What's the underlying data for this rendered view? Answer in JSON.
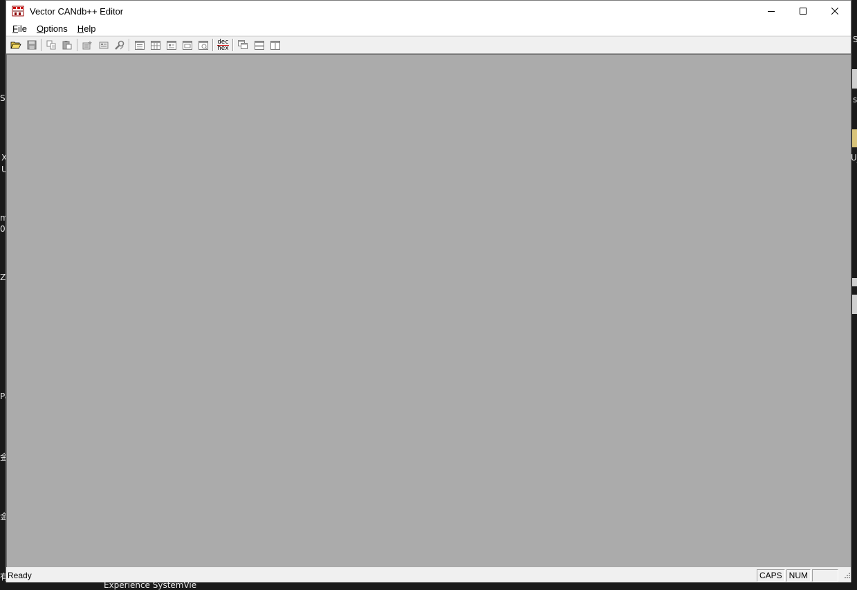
{
  "window": {
    "title": "Vector CANdb++ Editor"
  },
  "menu": {
    "file": {
      "accel": "F",
      "rest": "ile"
    },
    "options": {
      "accel": "O",
      "rest": "ptions"
    },
    "help": {
      "accel": "H",
      "rest": "elp"
    }
  },
  "toolbar": {
    "dec_hex_top": "dec",
    "dec_hex_bottom": "hex"
  },
  "statusbar": {
    "text": "Ready",
    "caps": "CAPS",
    "num": "NUM"
  },
  "desktop": {
    "fragments": [
      "S",
      "X",
      "U",
      "m",
      "0",
      "Z",
      "Pa",
      "金",
      "金",
      "有",
      "Experience   SystemVie",
      "S",
      "s",
      "U_"
    ]
  },
  "colors": {
    "client_bg": "#ababab",
    "chrome_bg": "#f0f0f0",
    "titlebar_bg": "#ffffff"
  }
}
